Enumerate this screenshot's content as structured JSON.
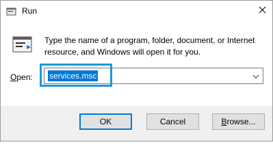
{
  "window": {
    "title": "Run",
    "close_glyph": "✕"
  },
  "dialog": {
    "icon": "run-app-icon",
    "description": "Type the name of a program, folder, document, or Internet resource, and Windows will open it for you.",
    "open_label_underlined": "O",
    "open_label_rest": "pen:",
    "input_value": "services.msc",
    "dropdown_glyph": "⌄"
  },
  "buttons": {
    "ok": "OK",
    "cancel": "Cancel",
    "browse_underlined": "B",
    "browse_rest": "rowse..."
  },
  "colors": {
    "selection": "#0078d7",
    "highlight_box": "#1a9ad6",
    "footer_bg": "#f0f0f0"
  }
}
